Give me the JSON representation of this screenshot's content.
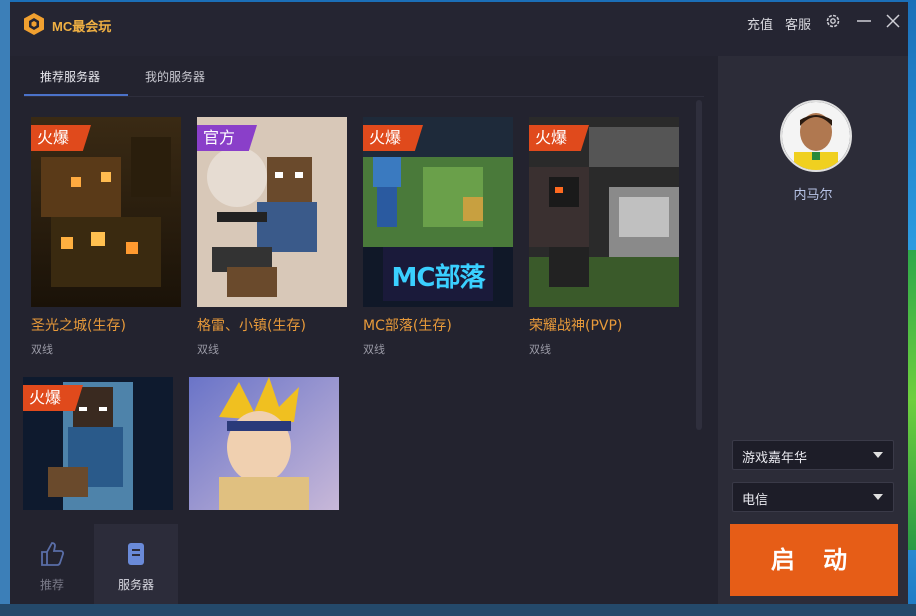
{
  "app": {
    "title": "MC最会玩"
  },
  "titlebar": {
    "recharge": "充值",
    "service": "客服"
  },
  "tabs": [
    {
      "label": "推荐服务器"
    },
    {
      "label": "我的服务器"
    }
  ],
  "servers": [
    {
      "name": "圣光之城(生存)",
      "line": "双线",
      "badge": "火爆"
    },
    {
      "name": "格雷、小镇(生存)",
      "line": "双线",
      "badge": "官方"
    },
    {
      "name": "MC部落(生存)",
      "line": "双线",
      "badge": "火爆",
      "thumb_text": "MC部落"
    },
    {
      "name": "荣耀战神(PVP)",
      "line": "双线",
      "badge": "火爆"
    },
    {
      "name": "",
      "line": "",
      "badge": "火爆"
    },
    {
      "name": "",
      "line": "",
      "badge": ""
    }
  ],
  "bottomnav": [
    {
      "label": "推荐"
    },
    {
      "label": "服务器"
    }
  ],
  "profile": {
    "username": "内马尔"
  },
  "selects": {
    "mode": "游戏嘉年华",
    "network": "电信"
  },
  "start_button": "启 动",
  "colors": {
    "accent": "#e65d17",
    "hot_badge": "#e04a1c",
    "official_badge": "#8a3fc9",
    "server_name": "#e89a3a"
  }
}
